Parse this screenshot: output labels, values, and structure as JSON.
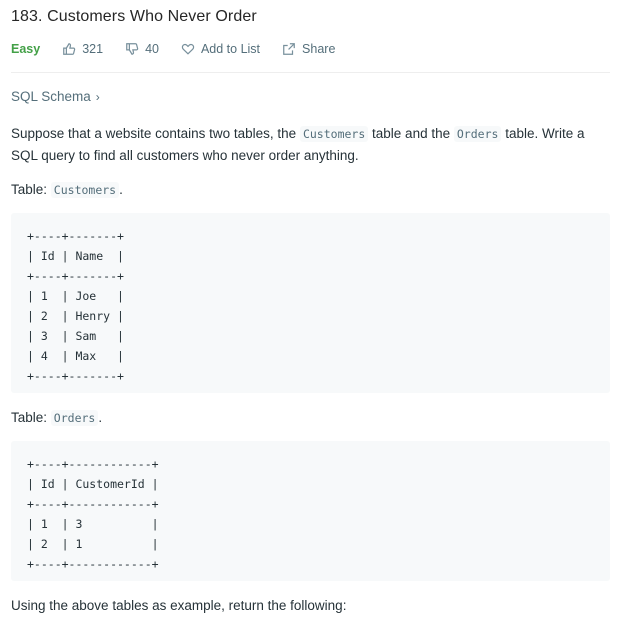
{
  "problem": {
    "title": "183. Customers Who Never Order",
    "difficulty": "Easy",
    "likes": "321",
    "dislikes": "40",
    "add_to_list_label": "Add to List",
    "share_label": "Share",
    "schema_link": "SQL Schema",
    "schema_chevron": "›"
  },
  "description": {
    "intro_part1": "Suppose that a website contains two tables, the",
    "intro_code1": "Customers",
    "intro_part2": "table and the",
    "intro_code2": "Orders",
    "intro_part3": "table. Write a",
    "intro_line2": "SQL query to find all customers who never order anything.",
    "table1_label": "Table:",
    "table1_name": "Customers",
    "table1_lines": [
      "+----+-------+",
      "| Id | Name  |",
      "+----+-------+",
      "| 1  | Joe   |",
      "| 2  | Henry |",
      "| 3  | Sam   |",
      "| 4  | Max   |",
      "+----+-------+"
    ],
    "table2_label": "Table:",
    "table2_name": "Orders",
    "table2_lines": [
      "+----+------------+",
      "| Id | CustomerId |",
      "+----+------------+",
      "| 1  | 3          |",
      "| 2  | 1          |",
      "+----+------------+"
    ],
    "closing": "Using the above tables as example, return the following:",
    "period": "."
  },
  "colors": {
    "easy": "#43a047",
    "muted": "#546e7a",
    "code_bg": "#f7f9fa"
  },
  "icons": [
    "thumbs-up-icon",
    "thumbs-down-icon",
    "heart-icon",
    "share-icon"
  ]
}
